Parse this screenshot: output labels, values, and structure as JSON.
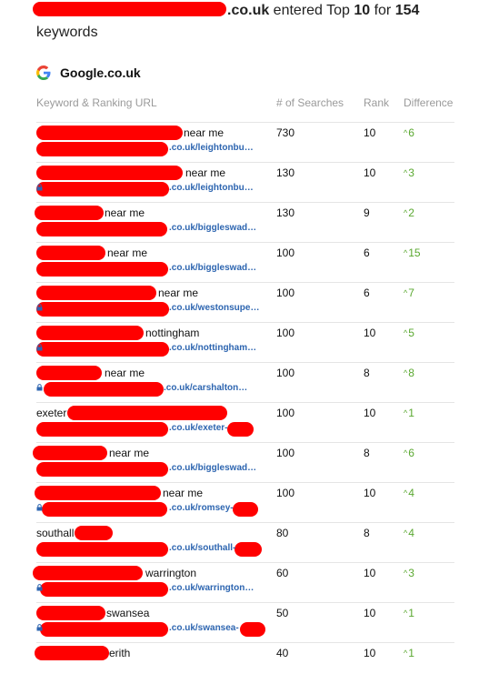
{
  "header": {
    "domain_suffix": ".co.uk",
    "text_entered": " entered Top ",
    "top_n": "10",
    "text_for": " for ",
    "keyword_count": "154",
    "text_keywords": "keywords"
  },
  "engine": {
    "name": "Google.co.uk",
    "icon": "google-g-icon"
  },
  "columns": {
    "keyword": "Keyword & Ranking URL",
    "searches": "# of Searches",
    "rank": "Rank",
    "difference": "Difference"
  },
  "colors": {
    "redaction": "#ff0000",
    "url": "#2d65b0",
    "difference_up": "#5aa830",
    "header_muted": "#9a9a9a"
  },
  "rows": [
    {
      "keyword": "near me",
      "url": ".co.uk/leightonbu…",
      "searches": "730",
      "rank": "10",
      "difference": "6",
      "lock": false
    },
    {
      "keyword": "near me",
      "url": ".co.uk/leightonbu…",
      "searches": "130",
      "rank": "10",
      "difference": "3",
      "lock": true
    },
    {
      "keyword": "near me",
      "url": ".co.uk/biggleswad…",
      "searches": "130",
      "rank": "9",
      "difference": "2",
      "lock": false
    },
    {
      "keyword": "near me",
      "url": ".co.uk/biggleswad…",
      "searches": "100",
      "rank": "6",
      "difference": "15",
      "lock": false
    },
    {
      "keyword": "near me",
      "url": ".co.uk/westonsupe…",
      "searches": "100",
      "rank": "6",
      "difference": "7",
      "lock": true
    },
    {
      "keyword": "nottingham",
      "url": ".co.uk/nottingham…",
      "searches": "100",
      "rank": "10",
      "difference": "5",
      "lock": true
    },
    {
      "keyword": "near me",
      "url": ".co.uk/carshalton…",
      "searches": "100",
      "rank": "8",
      "difference": "8",
      "lock": true
    },
    {
      "keyword": "exeter",
      "url": ".co.uk/exeter-",
      "searches": "100",
      "rank": "10",
      "difference": "1",
      "lock": false
    },
    {
      "keyword": "near me",
      "url": ".co.uk/biggleswad…",
      "searches": "100",
      "rank": "8",
      "difference": "6",
      "lock": false
    },
    {
      "keyword": "near me",
      "url": ".co.uk/romsey-",
      "searches": "100",
      "rank": "10",
      "difference": "4",
      "lock": true
    },
    {
      "keyword": "southall",
      "url": ".co.uk/southall-",
      "searches": "80",
      "rank": "8",
      "difference": "4",
      "lock": false
    },
    {
      "keyword": "warrington",
      "url": ".co.uk/warrington…",
      "searches": "60",
      "rank": "10",
      "difference": "3",
      "lock": true
    },
    {
      "keyword": "swansea",
      "url": ".co.uk/swansea-",
      "searches": "50",
      "rank": "10",
      "difference": "1",
      "lock": true
    },
    {
      "keyword": "erith",
      "url": "",
      "searches": "40",
      "rank": "10",
      "difference": "1",
      "lock": false
    }
  ]
}
